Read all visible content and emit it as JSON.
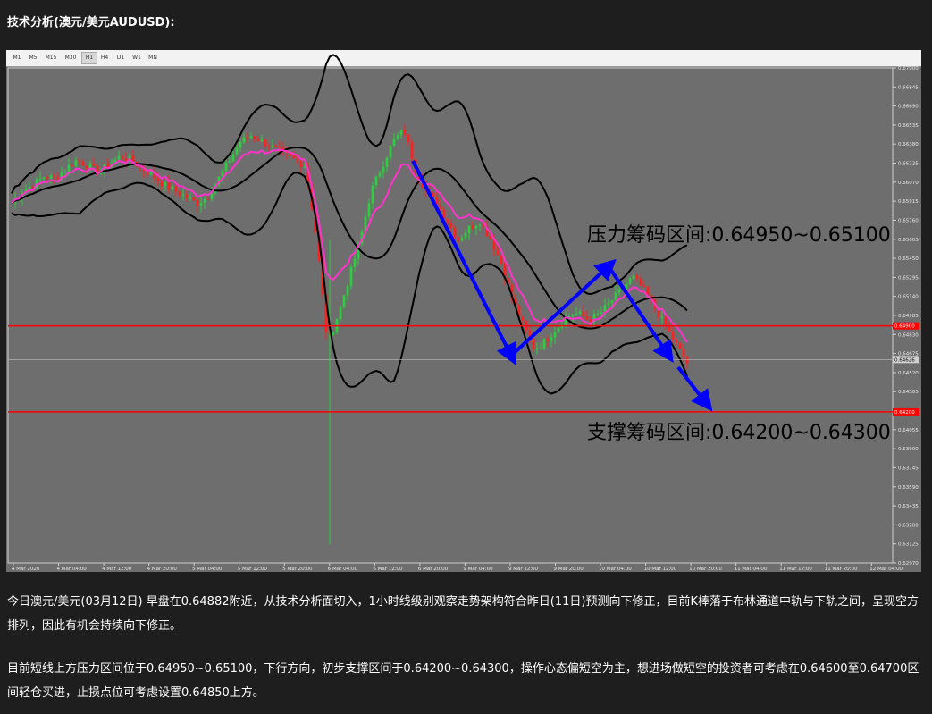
{
  "heading": "技术分析(澳元/美元AUDUSD):",
  "toolbar": {
    "timeframes": [
      "M1",
      "M5",
      "M15",
      "M30",
      "H1",
      "H4",
      "D1",
      "W1",
      "MN"
    ],
    "active": "H1"
  },
  "chart_data": {
    "type": "candlestick",
    "symbol": "AUDUSD",
    "timeframe": "H1",
    "ylim": [
      0.6297,
      0.67
    ],
    "y_ticks": [
      0.67,
      0.66845,
      0.6669,
      0.66535,
      0.6638,
      0.66225,
      0.6607,
      0.65915,
      0.6576,
      0.65605,
      0.6545,
      0.65295,
      0.6514,
      0.64985,
      0.6483,
      0.64675,
      0.6452,
      0.64365,
      0.6421,
      0.64055,
      0.639,
      0.63745,
      0.6359,
      0.63435,
      0.6328,
      0.63125,
      0.6297
    ],
    "x_ticks": [
      "4 Mar 2020",
      "4 Mar 04:00",
      "4 Mar 12:00",
      "4 Mar 20:00",
      "5 Mar 04:00",
      "5 Mar 12:00",
      "5 Mar 20:00",
      "6 Mar 04:00",
      "6 Mar 12:00",
      "6 Mar 20:00",
      "9 Mar 04:00",
      "9 Mar 12:00",
      "9 Mar 20:00",
      "10 Mar 04:00",
      "10 Mar 12:00",
      "10 Mar 20:00",
      "11 Mar 04:00",
      "11 Mar 12:00",
      "11 Mar 20:00",
      "12 Mar 04:00"
    ],
    "current_price": "0.64626",
    "horizontal_lines": [
      {
        "price": 0.649,
        "label": "0.64900",
        "color": "#ff0000"
      },
      {
        "price": 0.642,
        "label": "0.64200",
        "color": "#ff0000"
      }
    ],
    "annotations": [
      {
        "text": "压力筹码区间:0.64950~0.65100"
      },
      {
        "text": "支撑筹码区间:0.64200~0.64300"
      }
    ],
    "path_closes": [
      0.659,
      0.66,
      0.6605,
      0.6612,
      0.661,
      0.6618,
      0.6625,
      0.662,
      0.6615,
      0.6622,
      0.6628,
      0.6625,
      0.6618,
      0.6612,
      0.6605,
      0.66,
      0.6595,
      0.659,
      0.6595,
      0.661,
      0.6625,
      0.664,
      0.6645,
      0.664,
      0.6635,
      0.663,
      0.6625,
      0.662,
      0.656,
      0.6475,
      0.65,
      0.653,
      0.656,
      0.66,
      0.662,
      0.664,
      0.665,
      0.662,
      0.66,
      0.659,
      0.6575,
      0.656,
      0.657,
      0.6575,
      0.656,
      0.654,
      0.651,
      0.649,
      0.647,
      0.6478,
      0.6488,
      0.6498,
      0.65,
      0.6495,
      0.65,
      0.651,
      0.652,
      0.653,
      0.652,
      0.6505,
      0.649,
      0.6475,
      0.646
    ]
  },
  "paragraphs": [
    "今日澳元/美元(03月12日) 早盘在0.64882附近，从技术分析面切入，1小时线级别观察走势架构符合昨日(11日)预测向下修正，目前K棒落于布林通道中轨与下轨之间，呈现空方排列，因此有机会持续向下修正。",
    "目前短线上方压力区间位于0.64950~0.65100，下行方向，初步支撑区间于0.64200~0.64300，操作心态偏短空为主，想进场做短空的投资者可考虑在0.64600至0.64700区间轻仓买进，止损点位可考虑设置0.64850上方。"
  ],
  "colors": {
    "background": "#1e1e1e",
    "chart_bg": "#6e6e6e",
    "bull_candle": "#2ecc40",
    "bear_candle": "#ff2020",
    "bollinger": "#000000",
    "ma": "#ff33cc",
    "arrow": "#0000ff",
    "level_line": "#ff0000"
  }
}
